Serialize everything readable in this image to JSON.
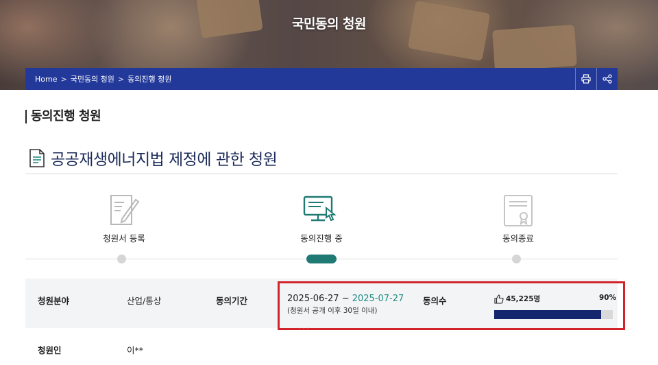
{
  "hero": {
    "title": "국민동의 청원"
  },
  "breadcrumb": {
    "items": [
      "Home",
      "국민동의 청원",
      "동의진행 청원"
    ],
    "separator": ">",
    "print_icon": "print-icon",
    "share_icon": "share-icon"
  },
  "section": {
    "title": "동의진행 청원"
  },
  "petition": {
    "title": "공공재생에너지법 제정에 관한 청원",
    "icon": "document-icon"
  },
  "steps": [
    {
      "label": "청원서 등록",
      "icon": "register-form-icon",
      "active": false
    },
    {
      "label": "동의진행 중",
      "icon": "monitor-click-icon",
      "active": true
    },
    {
      "label": "동의종료",
      "icon": "certificate-icon",
      "active": false
    }
  ],
  "info": {
    "field_label": "청원분야",
    "field_value": "산업/통상",
    "period_label": "동의기간",
    "period_start": "2025-06-27",
    "period_sep": " ~ ",
    "period_end": "2025-07-27",
    "period_note": "(청원서 공개 이후 30일 이내)",
    "count_label": "동의수",
    "count_value": "45,225명",
    "count_icon": "thumbs-up-icon",
    "percent_label": "90%",
    "progress": 0.9,
    "petitioner_label": "청원인",
    "petitioner_value": "이**"
  },
  "colors": {
    "accent_navy": "#23399a",
    "progress_fill": "#14266e",
    "active_step": "#1f7a73",
    "date_end": "#1f8c82",
    "highlight_border": "#d2232a"
  }
}
